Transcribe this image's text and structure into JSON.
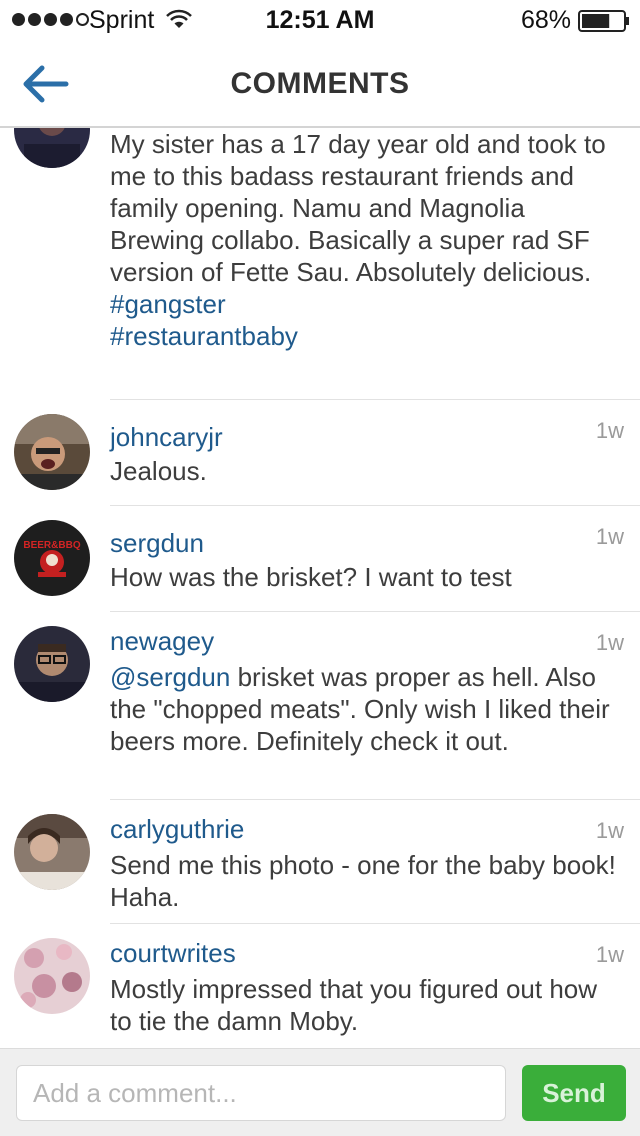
{
  "status_bar": {
    "carrier": "Sprint",
    "time": "12:51 AM",
    "battery_percent": "68%",
    "signal_bars_filled": 4,
    "signal_bars_total": 5,
    "battery_level": 0.68
  },
  "nav": {
    "title": "COMMENTS",
    "back_icon": "back-arrow-icon"
  },
  "caption": {
    "text": "My sister has a 17 day year old and took to me to this badass restaurant friends and family opening. Namu and Magnolia Brewing collabo. Basically a super rad SF version of Fette Sau. Absolutely delicious. ",
    "hashtag1": "#gangster",
    "hashtag2": "#restaurantbaby"
  },
  "comments": [
    {
      "username": "johncaryjr",
      "time": "1w",
      "text": "Jealous."
    },
    {
      "username": "sergdun",
      "time": "1w",
      "text": "How was the brisket? I want to test"
    },
    {
      "username": "newagey",
      "time": "1w",
      "mention": "@sergdun",
      "text": " brisket was proper as hell. Also the \"chopped meats\". Only wish I liked their beers more. Definitely check it out."
    },
    {
      "username": "carlyguthrie",
      "time": "1w",
      "text": "Send me this photo - one for the baby book! Haha."
    },
    {
      "username": "courtwrites",
      "time": "1w",
      "text": "Mostly impressed that you figured out how to tie the damn Moby."
    }
  ],
  "composer": {
    "placeholder": "Add a comment...",
    "send_label": "Send"
  },
  "colors": {
    "link": "#1f5a8c",
    "send_button": "#3aae3a",
    "back_arrow": "#2b6fa8"
  }
}
